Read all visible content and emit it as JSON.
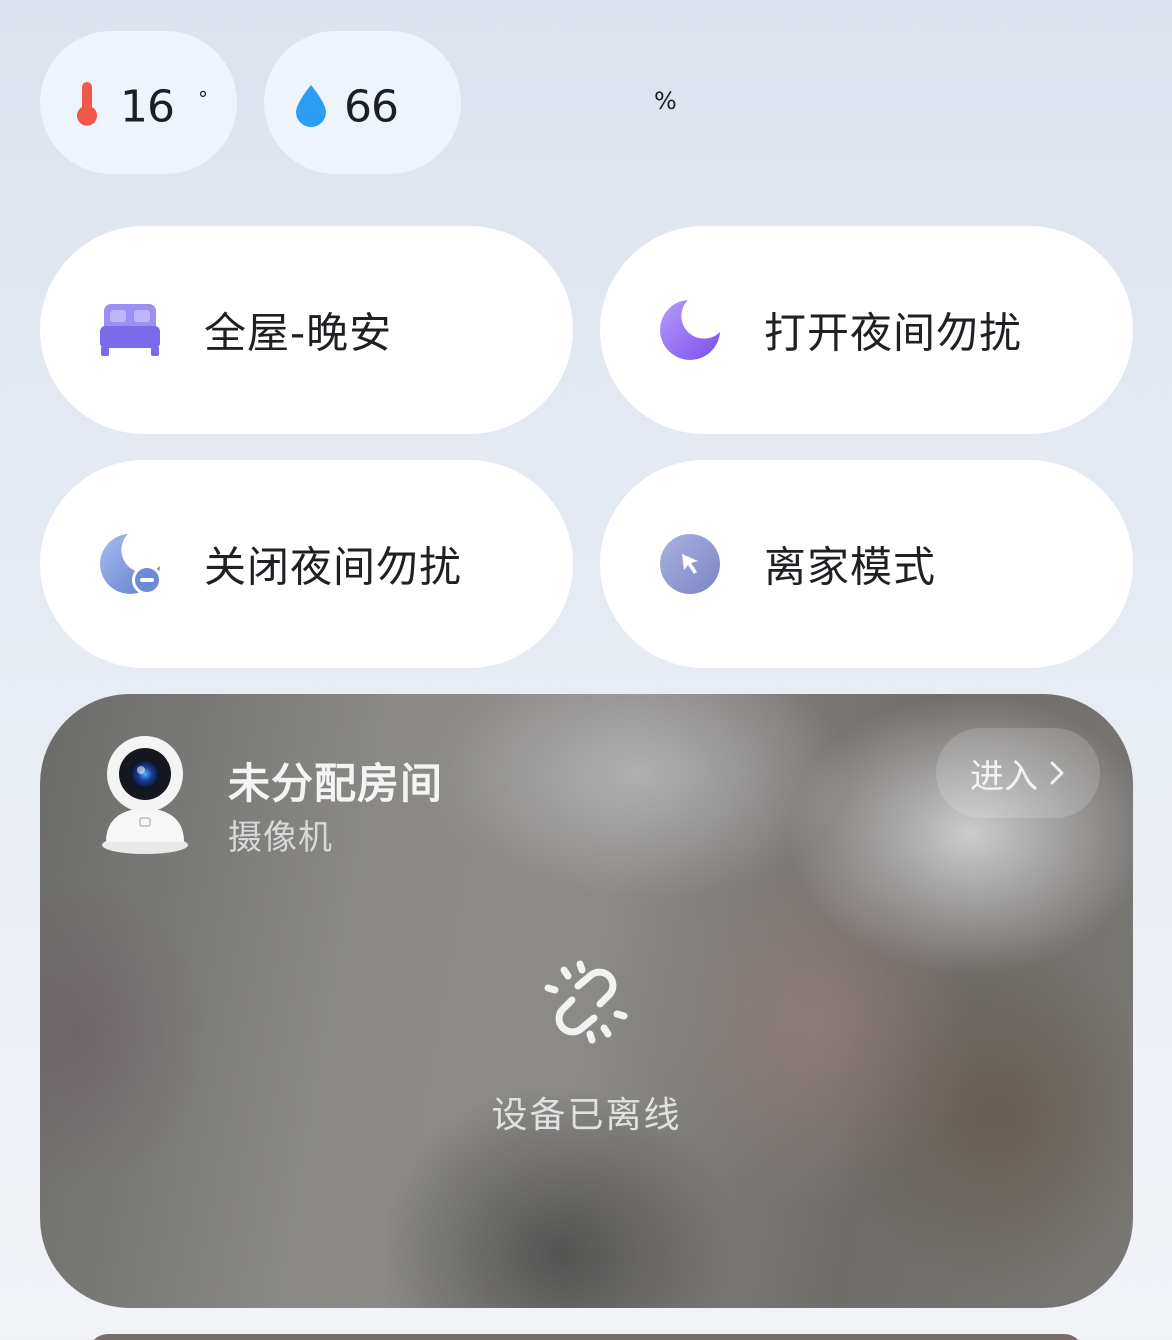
{
  "sensors": {
    "temperature": {
      "value": "16",
      "unit": "°",
      "icon": "thermometer-icon",
      "color": "#f0584a"
    },
    "humidity": {
      "value": "66",
      "unit": "%",
      "icon": "water-drop-icon",
      "color": "#2b9df2"
    }
  },
  "scenes": [
    {
      "label": "全屋-晚安",
      "icon": "bed-icon",
      "color": "#8c7cf2"
    },
    {
      "label": "打开夜间勿扰",
      "icon": "moon-icon",
      "color": "#8a63f0"
    },
    {
      "label": "关闭夜间勿扰",
      "icon": "moon-minus-icon",
      "color": "#6f8bd6"
    },
    {
      "label": "离家模式",
      "icon": "leave-home-arrow-icon",
      "color": "#8e97d0"
    }
  ],
  "camera": {
    "room": "未分配房间",
    "device_type": "摄像机",
    "enter_label": "进入",
    "status": "设备已离线",
    "status_icon": "broken-link-icon"
  }
}
